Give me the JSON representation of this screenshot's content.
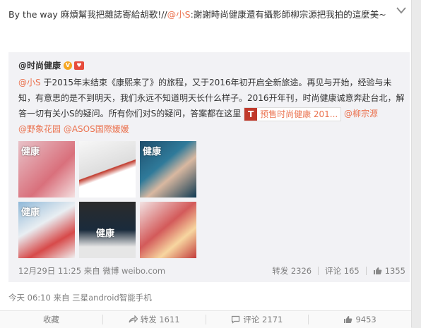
{
  "post": {
    "text_prefix": "By the way 麻煩幫我把雜誌寄給胡歌!//",
    "mention": "@小S",
    "text_suffix": ":謝謝時尚健康還有攝影師柳宗源把我拍的這麼美~",
    "meta": "今天 06:10 来自 三星android智能手机"
  },
  "repost": {
    "author": "@时尚健康",
    "mention1": "@小S",
    "line1": " 于2015年末结束《康熙来了》的旅程，又于2016年初开启全新旅途。再见与开始，经验与未知，有意思的是不到明天，我们永远不知道明天长什么样子。2016开年刊，时尚健康诚意奔赴台北，解答一切有关小S的疑问。所有你们对S的疑问，答案都在这里 ",
    "topic_icon": "T",
    "topic_label": "预售时尚健康 201...",
    "mention2": " @柳宗源",
    "mention3": "@野象花园",
    "mention4": " @ASOS国際媛媛",
    "thumb_tag": "健康",
    "time": "12月29日 11:25 来自 微博 weibo.com",
    "forward": "转发 2326",
    "comment": "评论 165",
    "like": "1355"
  },
  "bottom": {
    "favorite": "收藏",
    "forward": "转发 1611",
    "comment": "评论 2171",
    "like": "9453"
  },
  "colors": {
    "link": "#eb7350",
    "accent": "#fa7d3c"
  }
}
